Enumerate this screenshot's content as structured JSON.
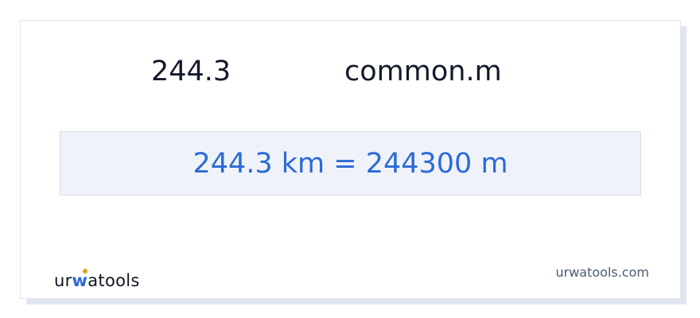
{
  "converter": {
    "input_value": "244.3",
    "target_unit": "common.m",
    "result": "244.3 km = 244300 m"
  },
  "footer": {
    "logo_prefix": "ur",
    "logo_highlight": "w",
    "logo_suffix": "atools",
    "site_url": "urwatools.com"
  },
  "colors": {
    "accent": "#2c6ad8",
    "text": "#141a2c",
    "result_bg": "#eff3f9",
    "logo_dot": "#e0a21b"
  }
}
